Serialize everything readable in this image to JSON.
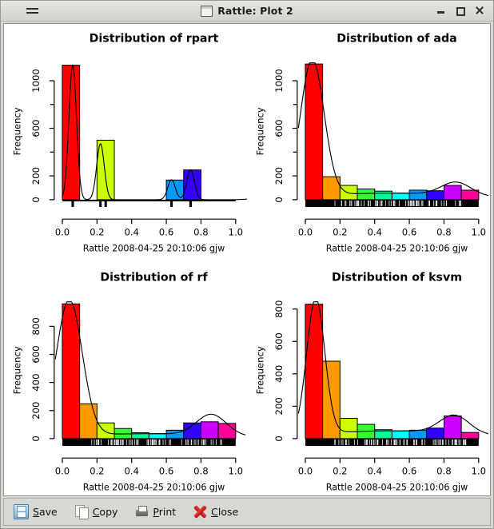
{
  "window": {
    "title": "Rattle: Plot 2",
    "menu_icon": "hamburger-menu-icon",
    "doc_icon": "window-document-icon",
    "buttons": {
      "minimize": "minimize-icon",
      "maximize": "maximize-icon",
      "close": "close-icon"
    }
  },
  "toolbar": {
    "items": [
      {
        "label": "Save",
        "accel": "S",
        "rest": "ave",
        "icon": "floppy-disk-icon"
      },
      {
        "label": "Copy",
        "accel": "C",
        "rest": "opy",
        "icon": "copy-pages-icon"
      },
      {
        "label": "Print",
        "accel": "P",
        "rest": "rint",
        "icon": "printer-icon"
      },
      {
        "label": "Close",
        "accel": "C",
        "rest": "lose",
        "icon": "red-x-icon"
      }
    ]
  },
  "palette": {
    "rainbow": [
      "#FF0000",
      "#FF9900",
      "#CCFF00",
      "#33FF33",
      "#00FF99",
      "#00FFFF",
      "#0099FF",
      "#3300FF",
      "#CC00FF",
      "#FF0099"
    ],
    "background": "#FFFFFF",
    "axis": "#000000"
  },
  "chart_data": [
    {
      "type": "bar",
      "id": "rpart",
      "title": "Distribution of rpart",
      "caption": "Rattle 2008-04-25 20:10:06 gjw",
      "xlabel": "",
      "ylabel": "Frequency",
      "xlim": [
        0.0,
        1.0
      ],
      "ylim": [
        0,
        1150
      ],
      "xticks": [
        "0.0",
        "0.2",
        "0.4",
        "0.6",
        "0.8",
        "1.0"
      ],
      "xtick_values": [
        0.0,
        0.2,
        0.4,
        0.6,
        0.8,
        1.0
      ],
      "yticks": [
        "0",
        "200",
        "600",
        "1000"
      ],
      "ytick_values": [
        0,
        200,
        600,
        1000
      ],
      "yminor_values": [
        400,
        800
      ],
      "grid": false,
      "legend": "none",
      "bins": [
        {
          "x0": 0.0,
          "x1": 0.1,
          "value": 1130,
          "color": "#FF0000"
        },
        {
          "x0": 0.2,
          "x1": 0.3,
          "value": 500,
          "color": "#CCFF00"
        },
        {
          "x0": 0.6,
          "x1": 0.7,
          "value": 165,
          "color": "#0099FF"
        },
        {
          "x0": 0.7,
          "x1": 0.8,
          "value": 250,
          "color": "#3300FF"
        }
      ],
      "rug_values": [
        0.06,
        0.22,
        0.25,
        0.63,
        0.74
      ],
      "density_peaks": [
        {
          "x": 0.06,
          "y": 1130
        },
        {
          "x": 0.22,
          "y": 470
        },
        {
          "x": 0.63,
          "y": 168
        },
        {
          "x": 0.74,
          "y": 252
        }
      ]
    },
    {
      "type": "bar",
      "id": "ada",
      "title": "Distribution of ada",
      "caption": "Rattle 2008-04-25 20:10:06 gjw",
      "xlabel": "",
      "ylabel": "Frequency",
      "xlim": [
        0.0,
        1.0
      ],
      "ylim": [
        0,
        1150
      ],
      "xticks": [
        "0.0",
        "0.2",
        "0.4",
        "0.6",
        "0.8",
        "1.0"
      ],
      "xtick_values": [
        0.0,
        0.2,
        0.4,
        0.6,
        0.8,
        1.0
      ],
      "yticks": [
        "0",
        "200",
        "600",
        "1000"
      ],
      "ytick_values": [
        0,
        200,
        600,
        1000
      ],
      "yminor_values": [
        400,
        800
      ],
      "grid": false,
      "legend": "none",
      "bins": [
        {
          "x0": 0.0,
          "x1": 0.1,
          "value": 1140,
          "color": "#FF0000"
        },
        {
          "x0": 0.1,
          "x1": 0.2,
          "value": 193,
          "color": "#FF9900"
        },
        {
          "x0": 0.2,
          "x1": 0.3,
          "value": 120,
          "color": "#CCFF00"
        },
        {
          "x0": 0.3,
          "x1": 0.4,
          "value": 90,
          "color": "#33FF33"
        },
        {
          "x0": 0.4,
          "x1": 0.5,
          "value": 72,
          "color": "#00FF99"
        },
        {
          "x0": 0.5,
          "x1": 0.6,
          "value": 55,
          "color": "#00FFFF"
        },
        {
          "x0": 0.6,
          "x1": 0.7,
          "value": 80,
          "color": "#0099FF"
        },
        {
          "x0": 0.7,
          "x1": 0.8,
          "value": 75,
          "color": "#3300FF"
        },
        {
          "x0": 0.8,
          "x1": 0.9,
          "value": 120,
          "color": "#CC00FF"
        },
        {
          "x0": 0.9,
          "x1": 1.0,
          "value": 80,
          "color": "#FF0099"
        }
      ],
      "density_peaks": [
        {
          "x": 0.04,
          "y": 1150
        },
        {
          "x": 0.87,
          "y": 140
        }
      ]
    },
    {
      "type": "bar",
      "id": "rf",
      "title": "Distribution of rf",
      "caption": "Rattle 2008-04-25 20:10:06 gjw",
      "xlabel": "",
      "ylabel": "Frequency",
      "xlim": [
        0.0,
        1.0
      ],
      "ylim": [
        0,
        975
      ],
      "xticks": [
        "0.0",
        "0.2",
        "0.4",
        "0.6",
        "0.8",
        "1.0"
      ],
      "xtick_values": [
        0.0,
        0.2,
        0.4,
        0.6,
        0.8,
        1.0
      ],
      "yticks": [
        "0",
        "200",
        "400",
        "600",
        "800"
      ],
      "ytick_values": [
        0,
        200,
        400,
        600,
        800
      ],
      "yminor_values": [],
      "grid": false,
      "legend": "none",
      "bins": [
        {
          "x0": 0.0,
          "x1": 0.1,
          "value": 960,
          "color": "#FF0000"
        },
        {
          "x0": 0.1,
          "x1": 0.2,
          "value": 248,
          "color": "#FF9900"
        },
        {
          "x0": 0.2,
          "x1": 0.3,
          "value": 112,
          "color": "#CCFF00"
        },
        {
          "x0": 0.3,
          "x1": 0.4,
          "value": 72,
          "color": "#33FF33"
        },
        {
          "x0": 0.4,
          "x1": 0.5,
          "value": 42,
          "color": "#00FF99"
        },
        {
          "x0": 0.5,
          "x1": 0.6,
          "value": 35,
          "color": "#00FFFF"
        },
        {
          "x0": 0.6,
          "x1": 0.7,
          "value": 60,
          "color": "#0099FF"
        },
        {
          "x0": 0.7,
          "x1": 0.8,
          "value": 112,
          "color": "#3300FF"
        },
        {
          "x0": 0.8,
          "x1": 0.9,
          "value": 120,
          "color": "#CC00FF"
        },
        {
          "x0": 0.9,
          "x1": 1.0,
          "value": 108,
          "color": "#FF0099"
        }
      ],
      "density_peaks": [
        {
          "x": 0.04,
          "y": 970
        },
        {
          "x": 0.86,
          "y": 190
        }
      ]
    },
    {
      "type": "bar",
      "id": "ksvm",
      "title": "Distribution of ksvm",
      "caption": "Rattle 2008-04-25 20:10:06 gjw",
      "xlabel": "",
      "ylabel": "Frequency",
      "xlim": [
        0.0,
        1.0
      ],
      "ylim": [
        0,
        845
      ],
      "xticks": [
        "0.0",
        "0.2",
        "0.4",
        "0.6",
        "0.8",
        "1.0"
      ],
      "xtick_values": [
        0.0,
        0.2,
        0.4,
        0.6,
        0.8,
        1.0
      ],
      "yticks": [
        "0",
        "200",
        "400",
        "600",
        "800"
      ],
      "ytick_values": [
        0,
        200,
        400,
        600,
        800
      ],
      "yminor_values": [],
      "grid": false,
      "legend": "none",
      "bins": [
        {
          "x0": 0.0,
          "x1": 0.1,
          "value": 830,
          "color": "#FF0000"
        },
        {
          "x0": 0.1,
          "x1": 0.2,
          "value": 478,
          "color": "#FF9900"
        },
        {
          "x0": 0.2,
          "x1": 0.3,
          "value": 125,
          "color": "#CCFF00"
        },
        {
          "x0": 0.3,
          "x1": 0.4,
          "value": 88,
          "color": "#33FF33"
        },
        {
          "x0": 0.4,
          "x1": 0.5,
          "value": 55,
          "color": "#00FF99"
        },
        {
          "x0": 0.5,
          "x1": 0.6,
          "value": 48,
          "color": "#00FFFF"
        },
        {
          "x0": 0.6,
          "x1": 0.7,
          "value": 52,
          "color": "#0099FF"
        },
        {
          "x0": 0.7,
          "x1": 0.8,
          "value": 65,
          "color": "#3300FF"
        },
        {
          "x0": 0.8,
          "x1": 0.9,
          "value": 140,
          "color": "#CC00FF"
        },
        {
          "x0": 0.9,
          "x1": 1.0,
          "value": 38,
          "color": "#FF0099"
        }
      ],
      "density_peaks": [
        {
          "x": 0.06,
          "y": 838
        },
        {
          "x": 0.86,
          "y": 142
        }
      ]
    }
  ]
}
